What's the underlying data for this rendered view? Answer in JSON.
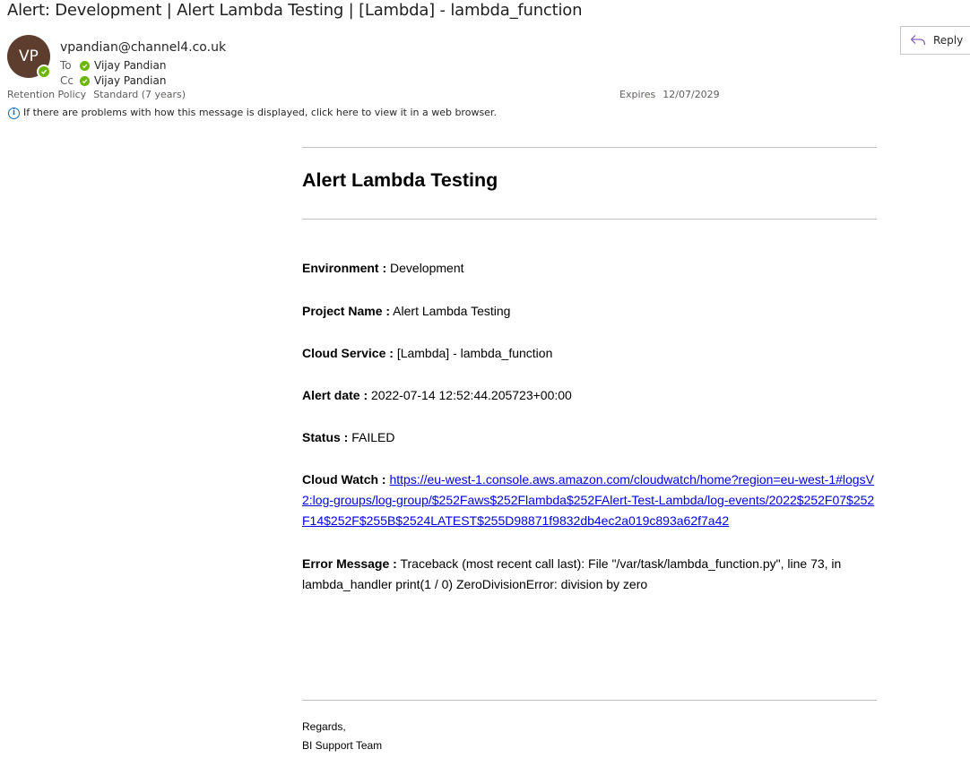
{
  "message": {
    "subject": "Alert: Development | Alert Lambda Testing | [Lambda] - lambda_function",
    "avatar_initials": "VP",
    "sender": "vpandian@channel4.co.uk",
    "to_label": "To",
    "to_name": "Vijay Pandian",
    "cc_label": "Cc",
    "cc_name": "Vijay Pandian",
    "retention_label": "Retention Policy",
    "retention_value": "Standard (7 years)",
    "expires_label": "Expires",
    "expires_value": "12/07/2029",
    "info_text": "If there are problems with how this message is displayed, click here to view it in a web browser.",
    "reply_label": "Reply"
  },
  "body": {
    "title": "Alert Lambda Testing",
    "environment_label": "Environment :",
    "environment_value": "Development",
    "project_label": "Project Name :",
    "project_value": "Alert Lambda Testing",
    "service_label": "Cloud Service :",
    "service_value": "[Lambda] - lambda_function",
    "date_label": "Alert date :",
    "date_value": "2022-07-14 12:52:44.205723+00:00",
    "status_label": "Status :",
    "status_value": "FAILED",
    "cloudwatch_label": "Cloud Watch :",
    "cloudwatch_link": "https://eu-west-1.console.aws.amazon.com/cloudwatch/home?region=eu-west-1#logsV2:log-groups/log-group/$252Faws$252Flambda$252FAlert-Test-Lambda/log-events/2022$252F07$252F14$252F$255B$2524LATEST$255D98871f9832db4ec2a019c893a62f7a42",
    "error_label": "Error Message :",
    "error_value": "Traceback (most recent call last): File \"/var/task/lambda_function.py\", line 73, in lambda_handler print(1 / 0) ZeroDivisionError: division by zero",
    "regards": "Regards,",
    "team": "BI Support Team"
  },
  "colors": {
    "avatar": "#5c3d2e",
    "presence": "#6bb700",
    "link": "#0000ee",
    "info_icon": "#0f6cbd"
  }
}
